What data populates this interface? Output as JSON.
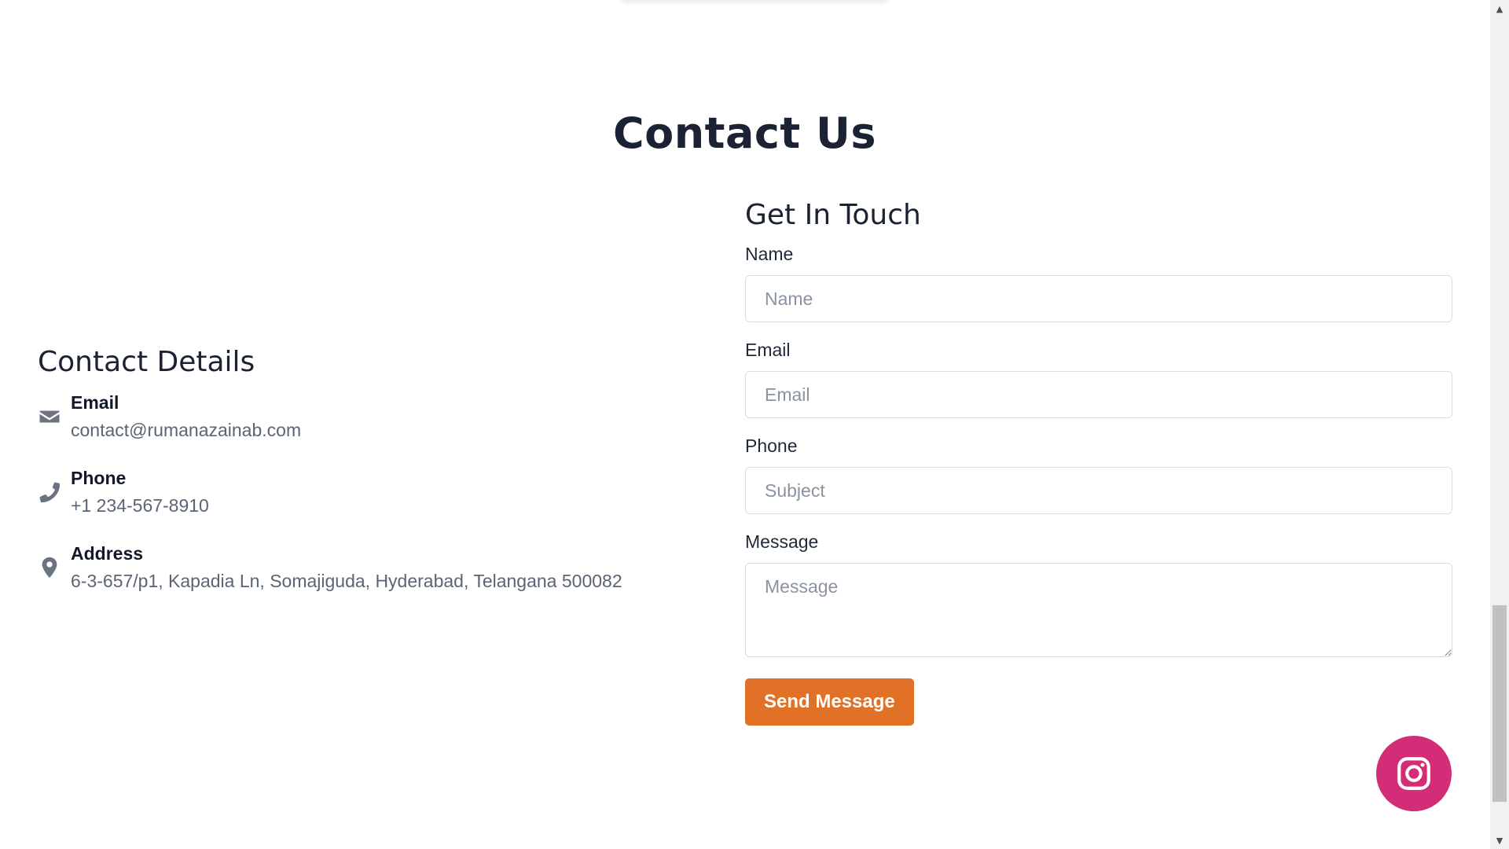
{
  "section": {
    "title": "Contact Us"
  },
  "details": {
    "heading": "Contact Details",
    "items": [
      {
        "icon": "envelope-icon",
        "label": "Email",
        "value": "contact@rumanazainab.com"
      },
      {
        "icon": "phone-icon",
        "label": "Phone",
        "value": "+1 234-567-8910"
      },
      {
        "icon": "map-pin-icon",
        "label": "Address",
        "value": "6-3-657/p1, Kapadia Ln, Somajiguda, Hyderabad, Telangana 500082"
      }
    ]
  },
  "form": {
    "heading": "Get In Touch",
    "name": {
      "label": "Name",
      "placeholder": "Name",
      "value": ""
    },
    "email": {
      "label": "Email",
      "placeholder": "Email",
      "value": ""
    },
    "phone": {
      "label": "Phone",
      "placeholder": "Subject",
      "value": ""
    },
    "message": {
      "label": "Message",
      "placeholder": "Message",
      "value": ""
    },
    "submit_label": "Send Message"
  },
  "social": {
    "icon": "instagram-icon",
    "color": "#d42d78"
  },
  "colors": {
    "accent": "#e07126",
    "heading": "#1a2233",
    "muted": "#5b6475"
  },
  "scrollbar": {
    "up_arrow": "▲",
    "down_arrow": "▼"
  }
}
